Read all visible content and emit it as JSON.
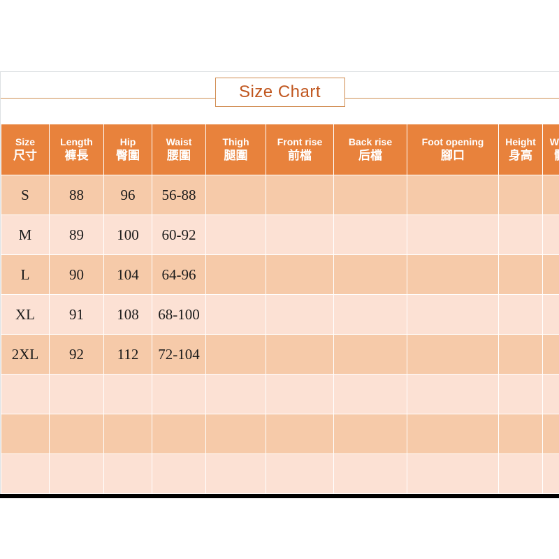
{
  "title": {
    "text": "Size Chart"
  },
  "colors": {
    "header_orange": "#E8823C",
    "row_dark": "#F6CAA9",
    "row_light": "#FCE1D4",
    "title_text": "#C0561E",
    "title_border": "#D08A4E",
    "rule": "#CF9055",
    "panel_border": "#DDE1E3",
    "bottom_bar": "#000000"
  },
  "table": {
    "columns": [
      {
        "en": "Size",
        "cn": "尺寸"
      },
      {
        "en": "Length",
        "cn": "褲長"
      },
      {
        "en": "Hip",
        "cn": "臀圍"
      },
      {
        "en": "Waist",
        "cn": "腰圍"
      },
      {
        "en": "Thigh",
        "cn": "腿圍"
      },
      {
        "en": "Front rise",
        "cn": "前檔"
      },
      {
        "en": "Back rise",
        "cn": "后檔"
      },
      {
        "en": "Foot opening",
        "cn": "腳口"
      },
      {
        "en": "Height",
        "cn": "身高"
      },
      {
        "en": "Weight",
        "cn": "體重"
      }
    ],
    "rows": [
      {
        "size": "S",
        "length": "88",
        "hip": "96",
        "waist": "56-88",
        "thigh": "",
        "front_rise": "",
        "back_rise": "",
        "foot_opening": "",
        "height": "",
        "weight": ""
      },
      {
        "size": "M",
        "length": "89",
        "hip": "100",
        "waist": "60-92",
        "thigh": "",
        "front_rise": "",
        "back_rise": "",
        "foot_opening": "",
        "height": "",
        "weight": ""
      },
      {
        "size": "L",
        "length": "90",
        "hip": "104",
        "waist": "64-96",
        "thigh": "",
        "front_rise": "",
        "back_rise": "",
        "foot_opening": "",
        "height": "",
        "weight": ""
      },
      {
        "size": "XL",
        "length": "91",
        "hip": "108",
        "waist": "68-100",
        "thigh": "",
        "front_rise": "",
        "back_rise": "",
        "foot_opening": "",
        "height": "",
        "weight": ""
      },
      {
        "size": "2XL",
        "length": "92",
        "hip": "112",
        "waist": "72-104",
        "thigh": "",
        "front_rise": "",
        "back_rise": "",
        "foot_opening": "",
        "height": "",
        "weight": ""
      },
      {
        "size": "",
        "length": "",
        "hip": "",
        "waist": "",
        "thigh": "",
        "front_rise": "",
        "back_rise": "",
        "foot_opening": "",
        "height": "",
        "weight": ""
      },
      {
        "size": "",
        "length": "",
        "hip": "",
        "waist": "",
        "thigh": "",
        "front_rise": "",
        "back_rise": "",
        "foot_opening": "",
        "height": "",
        "weight": ""
      },
      {
        "size": "",
        "length": "",
        "hip": "",
        "waist": "",
        "thigh": "",
        "front_rise": "",
        "back_rise": "",
        "foot_opening": "",
        "height": "",
        "weight": ""
      }
    ]
  }
}
